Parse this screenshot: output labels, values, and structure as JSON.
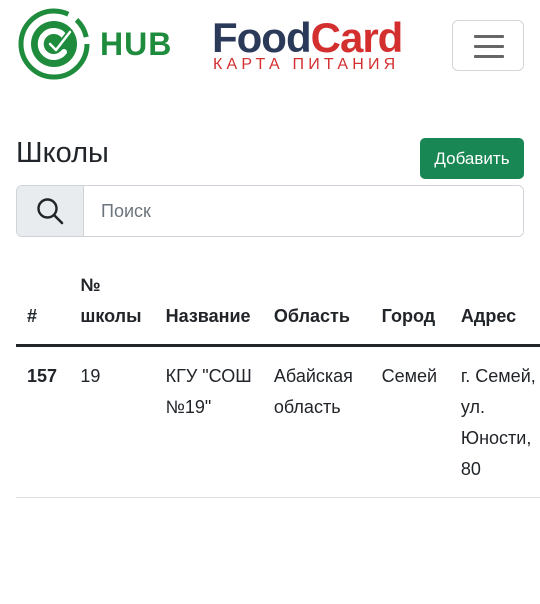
{
  "header": {
    "hub_text": "HUB",
    "foodcard_food": "Food",
    "foodcard_card": "Card",
    "foodcard_subtitle": "КАРТА ПИТАНИЯ"
  },
  "page": {
    "title": "Школы",
    "add_button": "Добавить"
  },
  "search": {
    "placeholder": "Поиск",
    "value": ""
  },
  "table": {
    "columns": [
      "#",
      "№ школы",
      "Название",
      "Область",
      "Город",
      "Адрес"
    ],
    "rows": [
      {
        "id": "157",
        "school_no": "19",
        "name": "КГУ \"СОШ №19\"",
        "region": "Абайская область",
        "city": "Семей",
        "address": "г. Семей, ул. Юности, 80"
      }
    ]
  },
  "colors": {
    "brand_green": "#198754",
    "hub_green": "#1e8c3c",
    "foodcard_navy": "#2c3a5a",
    "foodcard_red": "#d32f2f"
  }
}
